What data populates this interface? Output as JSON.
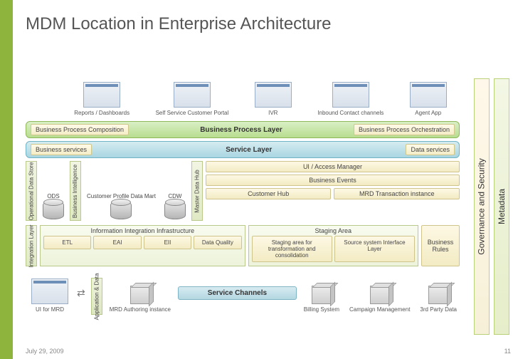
{
  "title": "MDM Location in Enterprise Architecture",
  "footer": {
    "date": "July 29, 2009",
    "page": "11"
  },
  "right_bars": {
    "governance": "Governance and Security",
    "metadata": "Metadata"
  },
  "top_apps": [
    {
      "label": "Reports / Dashboards"
    },
    {
      "label": "Self Service Customer Portal"
    },
    {
      "label": "IVR"
    },
    {
      "label": "Inbound Contact channels"
    },
    {
      "label": "Agent App"
    }
  ],
  "bp_layer": {
    "left": "Business Process Composition",
    "center": "Business Process Layer",
    "right": "Business Process Orchestration"
  },
  "service_layer": {
    "left": "Business services",
    "center": "Service Layer",
    "right": "Data services"
  },
  "middle": {
    "ods_label": "Operational Data Store",
    "ods": "ODS",
    "bi_label": "Business Intelligence",
    "bi_items": [
      "Customer Profile Data Mart",
      "CDW"
    ],
    "mdh_label": "Master Data Hub",
    "ui_access": "UI / Access Manager",
    "events": "Business Events",
    "cust_hub": "Customer  Hub",
    "mrd_trans": "MRD Transaction instance"
  },
  "iil": {
    "vlabel": "Integration Layer",
    "title": "Information Integration Infrastructure",
    "boxes": [
      "ETL",
      "EAI",
      "EII",
      "Data Quality"
    ],
    "staging_title": "Staging Area",
    "staging_boxes": [
      "Staging area for transformation and consolidation",
      "Source system Interface Layer"
    ],
    "rules": "Business Rules"
  },
  "bottom": {
    "ui_mrd": "UI for MRD",
    "app_data": "Application & Data",
    "mrd_auth": "MRD Authoring instance",
    "service_channels": "Service Channels",
    "billing": "Billing System",
    "campaign": "Campaign Management",
    "third": "3rd Party Data"
  }
}
